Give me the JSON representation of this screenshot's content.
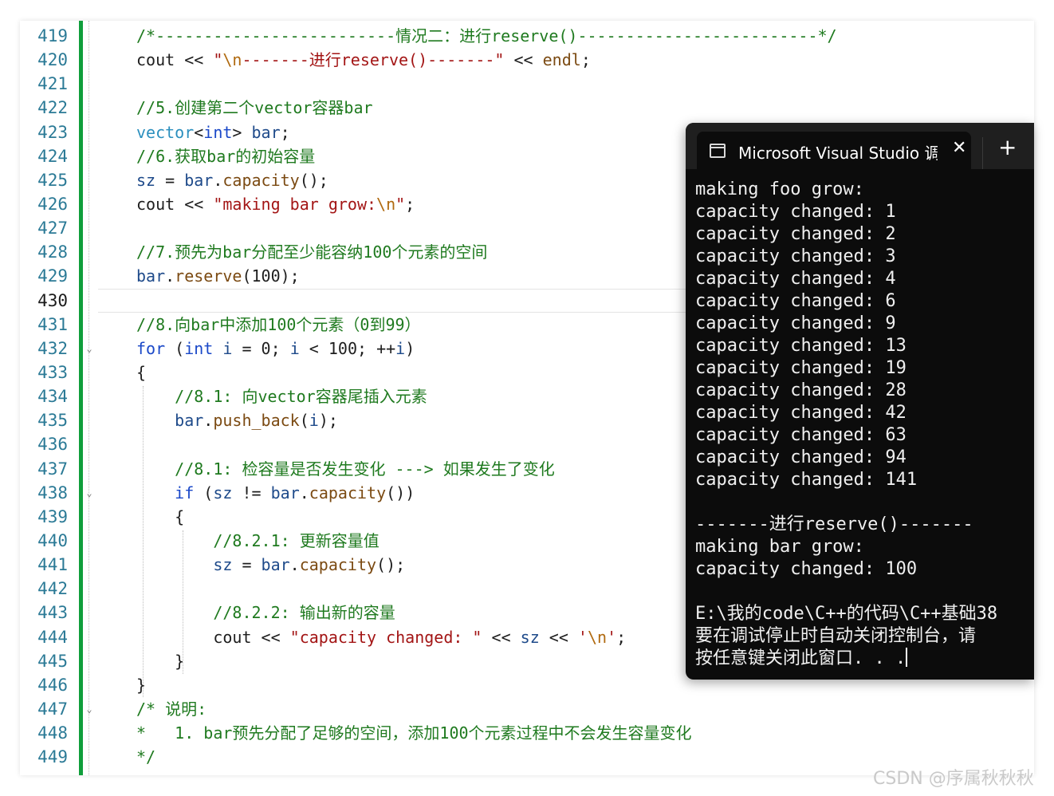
{
  "editor": {
    "line_numbers": [
      "419",
      "420",
      "421",
      "422",
      "423",
      "424",
      "425",
      "426",
      "427",
      "428",
      "429",
      "430",
      "431",
      "432",
      "433",
      "434",
      "435",
      "436",
      "437",
      "438",
      "439",
      "440",
      "441",
      "442",
      "443",
      "444",
      "445",
      "446",
      "447",
      "448",
      "449"
    ],
    "current_line": "430",
    "fold_markers": {
      "432": "⌄",
      "438": "⌄",
      "447": "⌄"
    },
    "lines": [
      [
        [
          "cm",
          "/*-------------------------情况二：进行reserve()-------------------------*/"
        ]
      ],
      [
        [
          "pl",
          "cout "
        ],
        [
          "pl",
          "<< "
        ],
        [
          "st",
          "\""
        ],
        [
          "es",
          "\\n"
        ],
        [
          "st",
          "-------进行reserve()-------\""
        ],
        [
          "pl",
          " << "
        ],
        [
          "fn",
          "endl"
        ],
        [
          "pl",
          ";"
        ]
      ],
      [],
      [
        [
          "cm",
          "//5.创建第二个vector容器bar"
        ]
      ],
      [
        [
          "ty",
          "vector"
        ],
        [
          "pl",
          "<"
        ],
        [
          "kw",
          "int"
        ],
        [
          "pl",
          "> "
        ],
        [
          "vr",
          "bar"
        ],
        [
          "pl",
          ";"
        ]
      ],
      [
        [
          "cm",
          "//6.获取bar的初始容量"
        ]
      ],
      [
        [
          "vr",
          "sz"
        ],
        [
          "pl",
          " = "
        ],
        [
          "vr",
          "bar"
        ],
        [
          "pl",
          "."
        ],
        [
          "fn",
          "capacity"
        ],
        [
          "pl",
          "();"
        ]
      ],
      [
        [
          "pl",
          "cout << "
        ],
        [
          "st",
          "\"making bar grow:"
        ],
        [
          "es",
          "\\n"
        ],
        [
          "st",
          "\""
        ],
        [
          "pl",
          ";"
        ]
      ],
      [],
      [
        [
          "cm",
          "//7.预先为bar分配至少能容纳100个元素的空间"
        ]
      ],
      [
        [
          "vr",
          "bar"
        ],
        [
          "pl",
          "."
        ],
        [
          "fn",
          "reserve"
        ],
        [
          "pl",
          "(100);"
        ]
      ],
      [],
      [
        [
          "cm",
          "//8.向bar中添加100个元素（0到99）"
        ]
      ],
      [
        [
          "kw",
          "for"
        ],
        [
          "pl",
          " ("
        ],
        [
          "kw",
          "int"
        ],
        [
          "pl",
          " "
        ],
        [
          "vr",
          "i"
        ],
        [
          "pl",
          " = 0; "
        ],
        [
          "vr",
          "i"
        ],
        [
          "pl",
          " < 100; ++"
        ],
        [
          "vr",
          "i"
        ],
        [
          "pl",
          ")"
        ]
      ],
      [
        [
          "pl",
          "{"
        ]
      ],
      [
        [
          "pl",
          "    "
        ],
        [
          "cm",
          "//8.1: 向vector容器尾插入元素"
        ]
      ],
      [
        [
          "pl",
          "    "
        ],
        [
          "vr",
          "bar"
        ],
        [
          "pl",
          "."
        ],
        [
          "fn",
          "push_back"
        ],
        [
          "pl",
          "("
        ],
        [
          "vr",
          "i"
        ],
        [
          "pl",
          ");"
        ]
      ],
      [],
      [
        [
          "pl",
          "    "
        ],
        [
          "cm",
          "//8.1: 检容量是否发生变化 ---> 如果发生了变化"
        ]
      ],
      [
        [
          "pl",
          "    "
        ],
        [
          "kw",
          "if"
        ],
        [
          "pl",
          " ("
        ],
        [
          "vr",
          "sz"
        ],
        [
          "pl",
          " != "
        ],
        [
          "vr",
          "bar"
        ],
        [
          "pl",
          "."
        ],
        [
          "fn",
          "capacity"
        ],
        [
          "pl",
          "())"
        ]
      ],
      [
        [
          "pl",
          "    {"
        ]
      ],
      [
        [
          "pl",
          "        "
        ],
        [
          "cm",
          "//8.2.1: 更新容量值"
        ]
      ],
      [
        [
          "pl",
          "        "
        ],
        [
          "vr",
          "sz"
        ],
        [
          "pl",
          " = "
        ],
        [
          "vr",
          "bar"
        ],
        [
          "pl",
          "."
        ],
        [
          "fn",
          "capacity"
        ],
        [
          "pl",
          "();"
        ]
      ],
      [],
      [
        [
          "pl",
          "        "
        ],
        [
          "cm",
          "//8.2.2: 输出新的容量"
        ]
      ],
      [
        [
          "pl",
          "        cout << "
        ],
        [
          "st",
          "\"capacity changed: \""
        ],
        [
          "pl",
          " << "
        ],
        [
          "vr",
          "sz"
        ],
        [
          "pl",
          " << "
        ],
        [
          "st",
          "'"
        ],
        [
          "es",
          "\\n"
        ],
        [
          "st",
          "'"
        ],
        [
          "pl",
          ";"
        ]
      ],
      [
        [
          "pl",
          "    }"
        ]
      ],
      [
        [
          "pl",
          "}"
        ]
      ],
      [
        [
          "cm",
          "/* 说明:"
        ]
      ],
      [
        [
          "cm",
          "*   1. bar预先分配了足够的空间，添加100个元素过程中不会发生容量变化"
        ]
      ],
      [
        [
          "cm",
          "*/"
        ]
      ]
    ]
  },
  "console": {
    "tab_title": "Microsoft Visual Studio 调试控制台",
    "close_glyph": "✕",
    "new_tab_glyph": "+",
    "output": [
      "making foo grow:",
      "capacity changed: 1",
      "capacity changed: 2",
      "capacity changed: 3",
      "capacity changed: 4",
      "capacity changed: 6",
      "capacity changed: 9",
      "capacity changed: 13",
      "capacity changed: 19",
      "capacity changed: 28",
      "capacity changed: 42",
      "capacity changed: 63",
      "capacity changed: 94",
      "capacity changed: 141",
      "",
      "-------进行reserve()-------",
      "making bar grow:",
      "capacity changed: 100",
      "",
      "E:\\我的code\\C++的代码\\C++基础38",
      "要在调试停止时自动关闭控制台，请",
      "按任意键关闭此窗口. . ."
    ]
  },
  "watermark": "CSDN @序属秋秋秋",
  "colors": {
    "change_bar": "#109e3b",
    "comment": "#1f7a1f",
    "keyword": "#1a48c8",
    "string": "#a31515",
    "console_bg": "#0c0c0c"
  }
}
